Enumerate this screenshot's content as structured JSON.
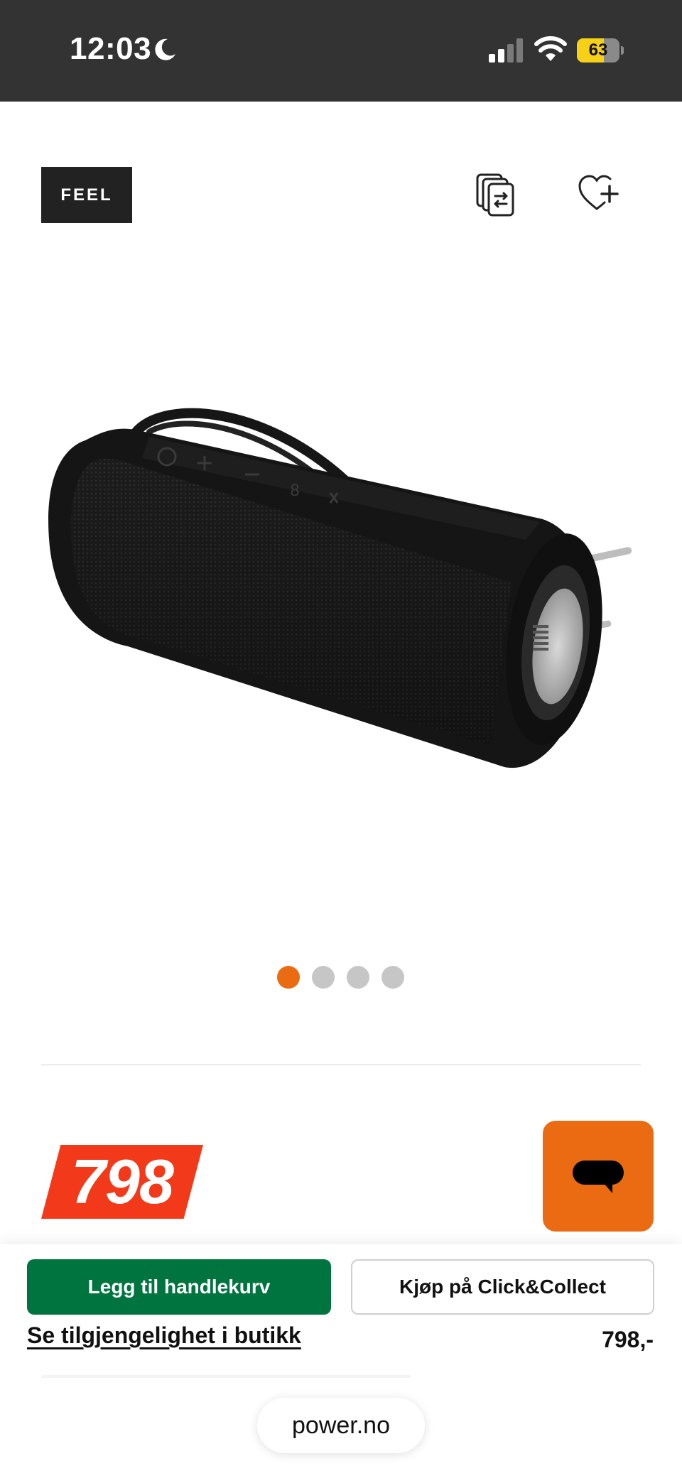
{
  "status_bar": {
    "time": "12:03",
    "battery_level": "63",
    "battery_fraction": 0.63
  },
  "header": {
    "brand": "FEEL",
    "compare_icon": "compare-icon",
    "wishlist_icon": "heart-plus-icon"
  },
  "carousel": {
    "total": 4,
    "active_index": 0
  },
  "price": {
    "badge": "798",
    "bottom": "798,-"
  },
  "actions": {
    "add_to_cart": "Legg til handlekurv",
    "click_collect": "Kjøp på Click&Collect",
    "store_availability": "Se tilgjengelighet i butikk"
  },
  "browser": {
    "url": "power.no"
  },
  "colors": {
    "accent_orange": "#ea6b12",
    "price_red": "#f23a1a",
    "cart_green": "#00743f",
    "status_bar": "#333333"
  }
}
